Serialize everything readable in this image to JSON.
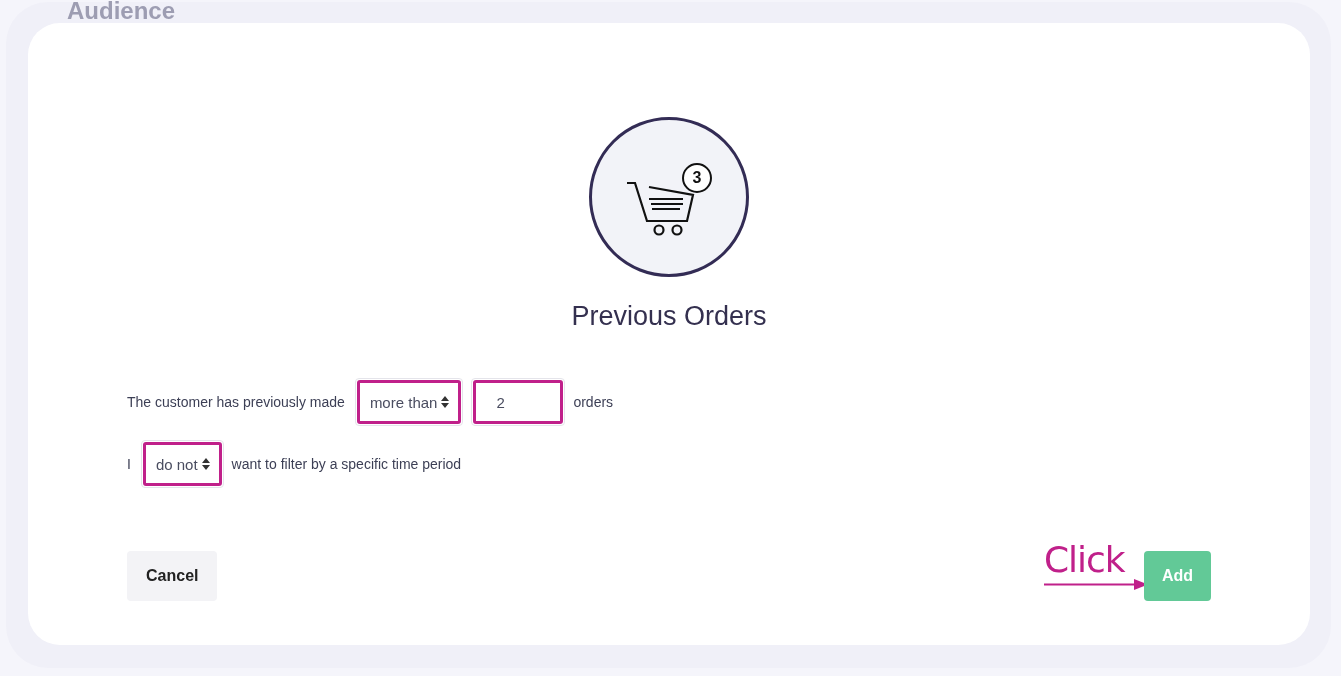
{
  "background": {
    "heading": "Audience"
  },
  "modal": {
    "title": "Previous Orders",
    "rows": [
      {
        "parts": [
          {
            "kind": "text",
            "text": "The customer has previously made"
          },
          {
            "kind": "select",
            "value": "more than",
            "highlighted": true
          },
          {
            "kind": "input",
            "value": "2",
            "highlighted": true
          },
          {
            "kind": "text",
            "text": "orders"
          }
        ]
      },
      {
        "parts": [
          {
            "kind": "text",
            "text": "I"
          },
          {
            "kind": "select",
            "value": "do not",
            "highlighted": true
          },
          {
            "kind": "text",
            "text": "want to filter by a specific time period"
          }
        ]
      }
    ],
    "cart_badge": "3",
    "buttons": {
      "cancel": "Cancel",
      "add": "Add"
    },
    "annotation": "Click"
  }
}
